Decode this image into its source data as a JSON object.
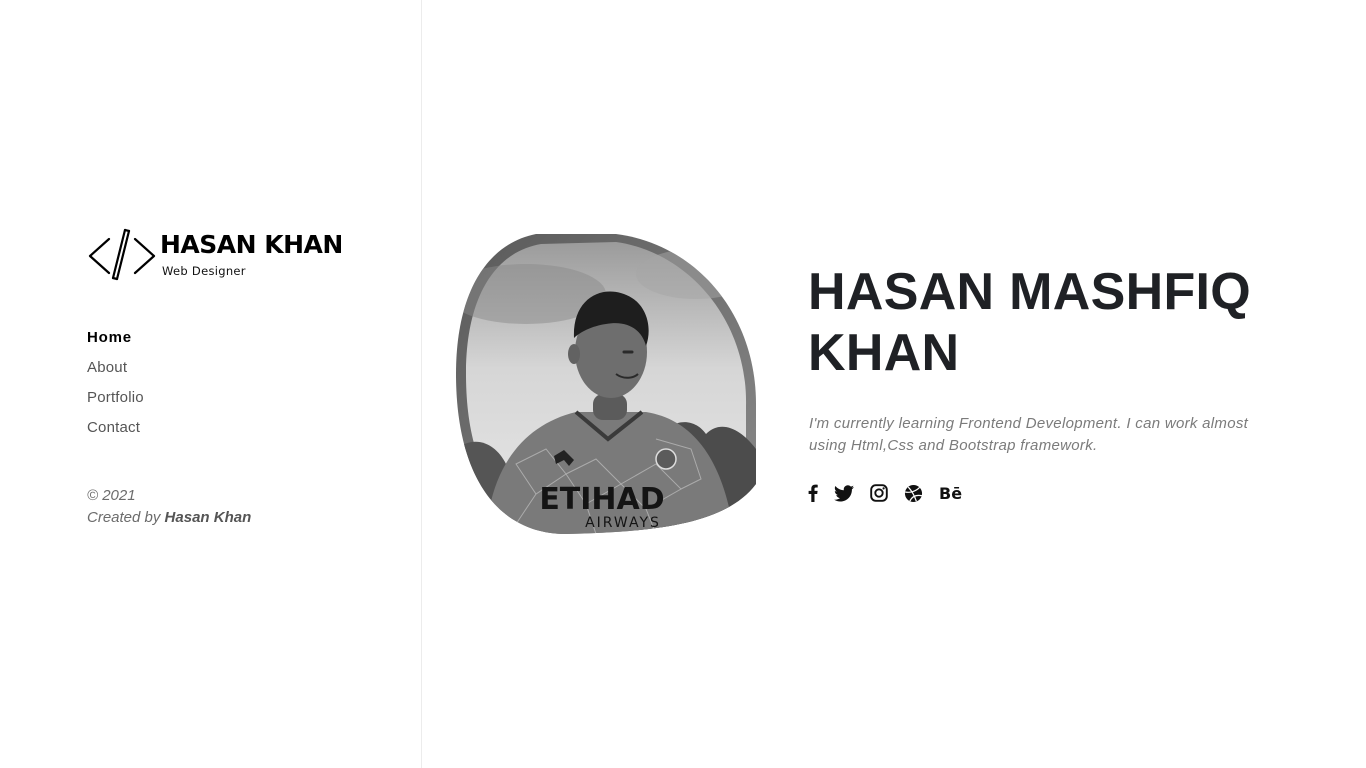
{
  "sidebar": {
    "logo": {
      "name": "HASAN KHAN",
      "subtitle": "Web Designer",
      "icon": "code-brackets-icon"
    },
    "nav": [
      {
        "label": "Home",
        "active": true
      },
      {
        "label": "About",
        "active": false
      },
      {
        "label": "Portfolio",
        "active": false
      },
      {
        "label": "Contact",
        "active": false
      }
    ],
    "footer": {
      "copyright": "© 2021",
      "created_by_prefix": "Created by",
      "author": "Hasan Khan"
    }
  },
  "hero": {
    "name_line1": "HASAN MASHFIQ",
    "name_line2": "KHAN",
    "bio": "I'm currently learning Frontend Development. I can work almost using Html,Css and Bootstrap framework.",
    "photo": {
      "shirt_text_1": "ETIHAD",
      "shirt_text_2": "AIRWAYS",
      "style": "grayscale",
      "icon": "profile-photo"
    },
    "social": [
      {
        "icon": "facebook-icon"
      },
      {
        "icon": "twitter-icon"
      },
      {
        "icon": "instagram-icon"
      },
      {
        "icon": "dribbble-icon"
      },
      {
        "icon": "behance-icon",
        "text": "Bē"
      }
    ]
  },
  "colors": {
    "heading": "#1f2125",
    "text_muted": "#7b7b7b",
    "nav_active": "#000000",
    "nav_inactive": "#555555",
    "divider": "#ececec"
  }
}
